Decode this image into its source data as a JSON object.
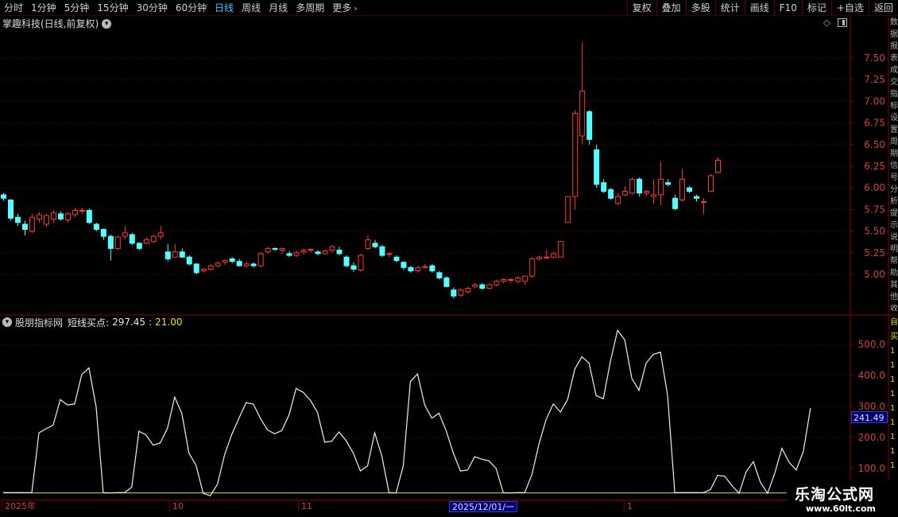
{
  "toolbar": {
    "tabs": [
      "分时",
      "1分钟",
      "5分钟",
      "15分钟",
      "30分钟",
      "60分钟",
      "日线",
      "周线",
      "月线",
      "多周期",
      "更多"
    ],
    "active_tab": "日线",
    "more_chevron": "›",
    "tools": [
      "复权",
      "叠加",
      "多股",
      "统计",
      "画线",
      "F10",
      "标记",
      "+自选",
      "返回"
    ]
  },
  "chart": {
    "title": "掌趣科技(日线,前复权)",
    "dropdown_glyph": "▾",
    "diamond_glyph": "◇"
  },
  "indicator": {
    "dropdown_glyph": "▾",
    "name": "股朋指标网",
    "label": "短线买点:",
    "value": "297.45",
    "sep": ":",
    "value2": "21.00",
    "current_value_tag": "241.49"
  },
  "dates": {
    "labels": [
      "2025年",
      "10",
      "11",
      "1"
    ],
    "cursor": "2025/12/01/一"
  },
  "watermark": {
    "main": "乐淘公式网",
    "sub": "www.60lt.com"
  },
  "side_chars_top": [
    "数",
    "据",
    "报",
    "表",
    "成",
    "交",
    "指",
    "标",
    "设",
    "置",
    "周",
    "期",
    "信",
    "号",
    "分",
    "析",
    "提",
    "示",
    "说",
    "明",
    "帮",
    "助",
    "其",
    "他",
    "收"
  ],
  "side_chars_bottom": [
    "自",
    "买",
    "1",
    "1",
    "1",
    "1",
    "1",
    "1",
    "1",
    "1",
    "1"
  ],
  "chart_data": {
    "type": "candlestick",
    "price_axis": {
      "ticks": [
        5.0,
        5.25,
        5.5,
        5.75,
        6.0,
        6.25,
        6.5,
        6.75,
        7.0,
        7.25,
        7.5
      ],
      "range": [
        4.6,
        7.75
      ]
    },
    "indicator_axis": {
      "ticks": [
        100.0,
        200.0,
        300.0,
        400.0,
        500.0
      ],
      "range": [
        0,
        560
      ],
      "baseline": 21.0
    },
    "candles": [
      [
        5.92,
        5.88,
        5.94,
        5.85
      ],
      [
        5.86,
        5.65,
        5.87,
        5.62
      ],
      [
        5.66,
        5.6,
        5.7,
        5.56
      ],
      [
        5.58,
        5.52,
        5.62,
        5.45
      ],
      [
        5.5,
        5.66,
        5.7,
        5.48
      ],
      [
        5.64,
        5.69,
        5.72,
        5.6
      ],
      [
        5.58,
        5.68,
        5.7,
        5.55
      ],
      [
        5.64,
        5.71,
        5.74,
        5.6
      ],
      [
        5.7,
        5.64,
        5.73,
        5.62
      ],
      [
        5.63,
        5.7,
        5.72,
        5.6
      ],
      [
        5.69,
        5.74,
        5.77,
        5.66
      ],
      [
        5.74,
        5.74,
        5.77,
        5.7
      ],
      [
        5.74,
        5.6,
        5.76,
        5.58
      ],
      [
        5.58,
        5.52,
        5.6,
        5.5
      ],
      [
        5.52,
        5.44,
        5.53,
        5.4
      ],
      [
        5.44,
        5.3,
        5.46,
        5.16
      ],
      [
        5.3,
        5.43,
        5.45,
        5.28
      ],
      [
        5.44,
        5.48,
        5.56,
        5.4
      ],
      [
        5.46,
        5.36,
        5.48,
        5.34
      ],
      [
        5.36,
        5.3,
        5.37,
        5.28
      ],
      [
        5.36,
        5.4,
        5.43,
        5.35
      ],
      [
        5.38,
        5.44,
        5.46,
        5.36
      ],
      [
        5.44,
        5.48,
        5.56,
        5.4
      ],
      [
        5.26,
        5.18,
        5.35,
        5.15
      ],
      [
        5.2,
        5.26,
        5.35,
        5.2
      ],
      [
        5.26,
        5.2,
        5.3,
        5.19
      ],
      [
        5.2,
        5.12,
        5.22,
        5.1
      ],
      [
        5.12,
        5.02,
        5.13,
        5.0
      ],
      [
        5.04,
        5.06,
        5.08,
        5.02
      ],
      [
        5.06,
        5.1,
        5.12,
        5.05
      ],
      [
        5.1,
        5.13,
        5.15,
        5.08
      ],
      [
        5.14,
        5.16,
        5.17,
        5.11
      ],
      [
        5.18,
        5.15,
        5.2,
        5.13
      ],
      [
        5.15,
        5.1,
        5.18,
        5.09
      ],
      [
        5.1,
        5.12,
        5.14,
        5.08
      ],
      [
        5.12,
        5.1,
        5.14,
        5.08
      ],
      [
        5.1,
        5.24,
        5.26,
        5.08
      ],
      [
        5.26,
        5.3,
        5.32,
        5.24
      ],
      [
        5.3,
        5.29,
        5.31,
        5.27
      ],
      [
        5.28,
        5.3,
        5.31,
        5.24
      ],
      [
        5.24,
        5.22,
        5.27,
        5.2
      ],
      [
        5.22,
        5.25,
        5.28,
        5.2
      ],
      [
        5.26,
        5.28,
        5.3,
        5.23
      ],
      [
        5.28,
        5.29,
        5.3,
        5.25
      ],
      [
        5.26,
        5.24,
        5.28,
        5.22
      ],
      [
        5.24,
        5.27,
        5.29,
        5.23
      ],
      [
        5.28,
        5.32,
        5.34,
        5.25
      ],
      [
        5.28,
        5.24,
        5.32,
        5.22
      ],
      [
        5.2,
        5.1,
        5.22,
        5.08
      ],
      [
        5.1,
        5.06,
        5.14,
        5.03
      ],
      [
        5.05,
        5.22,
        5.24,
        5.03
      ],
      [
        5.3,
        5.4,
        5.45,
        5.28
      ],
      [
        5.36,
        5.32,
        5.4,
        5.3
      ],
      [
        5.32,
        5.22,
        5.34,
        5.2
      ],
      [
        5.24,
        5.24,
        5.26,
        5.2
      ],
      [
        5.2,
        5.16,
        5.22,
        5.14
      ],
      [
        5.14,
        5.08,
        5.15,
        5.05
      ],
      [
        5.08,
        5.04,
        5.1,
        5.02
      ],
      [
        5.04,
        5.08,
        5.1,
        5.02
      ],
      [
        5.08,
        5.09,
        5.12,
        5.07
      ],
      [
        5.1,
        5.04,
        5.12,
        5.02
      ],
      [
        5.02,
        4.96,
        5.04,
        4.94
      ],
      [
        4.96,
        4.86,
        4.98,
        4.85
      ],
      [
        4.82,
        4.75,
        4.85,
        4.72
      ],
      [
        4.76,
        4.82,
        4.84,
        4.74
      ],
      [
        4.8,
        4.84,
        4.86,
        4.78
      ],
      [
        4.86,
        4.88,
        4.9,
        4.84
      ],
      [
        4.88,
        4.84,
        4.9,
        4.82
      ],
      [
        4.84,
        4.88,
        4.9,
        4.83
      ],
      [
        4.88,
        4.92,
        4.94,
        4.86
      ],
      [
        4.92,
        4.94,
        4.96,
        4.9
      ],
      [
        4.94,
        4.94,
        4.96,
        4.9
      ],
      [
        4.92,
        4.96,
        4.98,
        4.9
      ],
      [
        4.92,
        4.98,
        4.98,
        4.88
      ],
      [
        4.98,
        5.18,
        5.2,
        4.96
      ],
      [
        5.18,
        5.2,
        5.22,
        5.16
      ],
      [
        5.2,
        5.2,
        5.28,
        5.18
      ],
      [
        5.2,
        5.24,
        5.26,
        5.18
      ],
      [
        5.2,
        5.38,
        5.38,
        5.2
      ],
      [
        5.6,
        5.9,
        5.9,
        5.6
      ],
      [
        5.9,
        6.86,
        6.9,
        5.75
      ],
      [
        6.6,
        7.12,
        7.68,
        6.5
      ],
      [
        6.88,
        6.56,
        6.9,
        6.5
      ],
      [
        6.44,
        6.04,
        6.5,
        6.0
      ],
      [
        6.06,
        5.96,
        6.1,
        5.94
      ],
      [
        5.98,
        5.88,
        6.0,
        5.86
      ],
      [
        5.82,
        5.9,
        5.94,
        5.8
      ],
      [
        5.92,
        5.96,
        6.02,
        5.9
      ],
      [
        5.94,
        6.1,
        6.12,
        5.92
      ],
      [
        6.1,
        5.94,
        6.12,
        5.9
      ],
      [
        5.94,
        5.96,
        5.98,
        5.9
      ],
      [
        5.9,
        5.92,
        6.1,
        5.82
      ],
      [
        5.92,
        6.1,
        6.3,
        5.8
      ],
      [
        6.06,
        6.04,
        6.1,
        6.02
      ],
      [
        5.88,
        5.76,
        5.92,
        5.74
      ],
      [
        5.86,
        6.1,
        6.22,
        5.84
      ],
      [
        6.0,
        5.96,
        6.02,
        5.94
      ],
      [
        5.9,
        5.88,
        5.92,
        5.84
      ],
      [
        5.84,
        5.84,
        5.88,
        5.7
      ],
      [
        5.96,
        6.14,
        6.16,
        5.96
      ],
      [
        6.18,
        6.32,
        6.35,
        6.17
      ]
    ],
    "indicator_series": [
      22,
      22,
      22,
      22,
      22,
      215,
      228,
      240,
      322,
      305,
      308,
      403,
      424,
      300,
      22,
      21,
      22,
      22,
      40,
      220,
      208,
      175,
      183,
      230,
      330,
      278,
      150,
      110,
      20,
      12,
      50,
      145,
      210,
      262,
      312,
      308,
      262,
      224,
      212,
      222,
      272,
      358,
      345,
      320,
      280,
      185,
      188,
      218,
      190,
      150,
      92,
      108,
      215,
      140,
      22,
      21,
      108,
      380,
      405,
      305,
      262,
      278,
      222,
      150,
      92,
      95,
      138,
      130,
      125,
      100,
      22,
      21,
      22,
      22,
      80,
      180,
      258,
      308,
      282,
      322,
      420,
      460,
      440,
      335,
      325,
      445,
      545,
      515,
      390,
      352,
      440,
      468,
      475,
      335,
      22,
      22,
      22,
      22,
      22,
      32,
      78,
      75,
      45,
      20,
      90,
      122,
      55,
      20,
      85,
      165,
      120,
      95,
      155,
      295
    ]
  }
}
